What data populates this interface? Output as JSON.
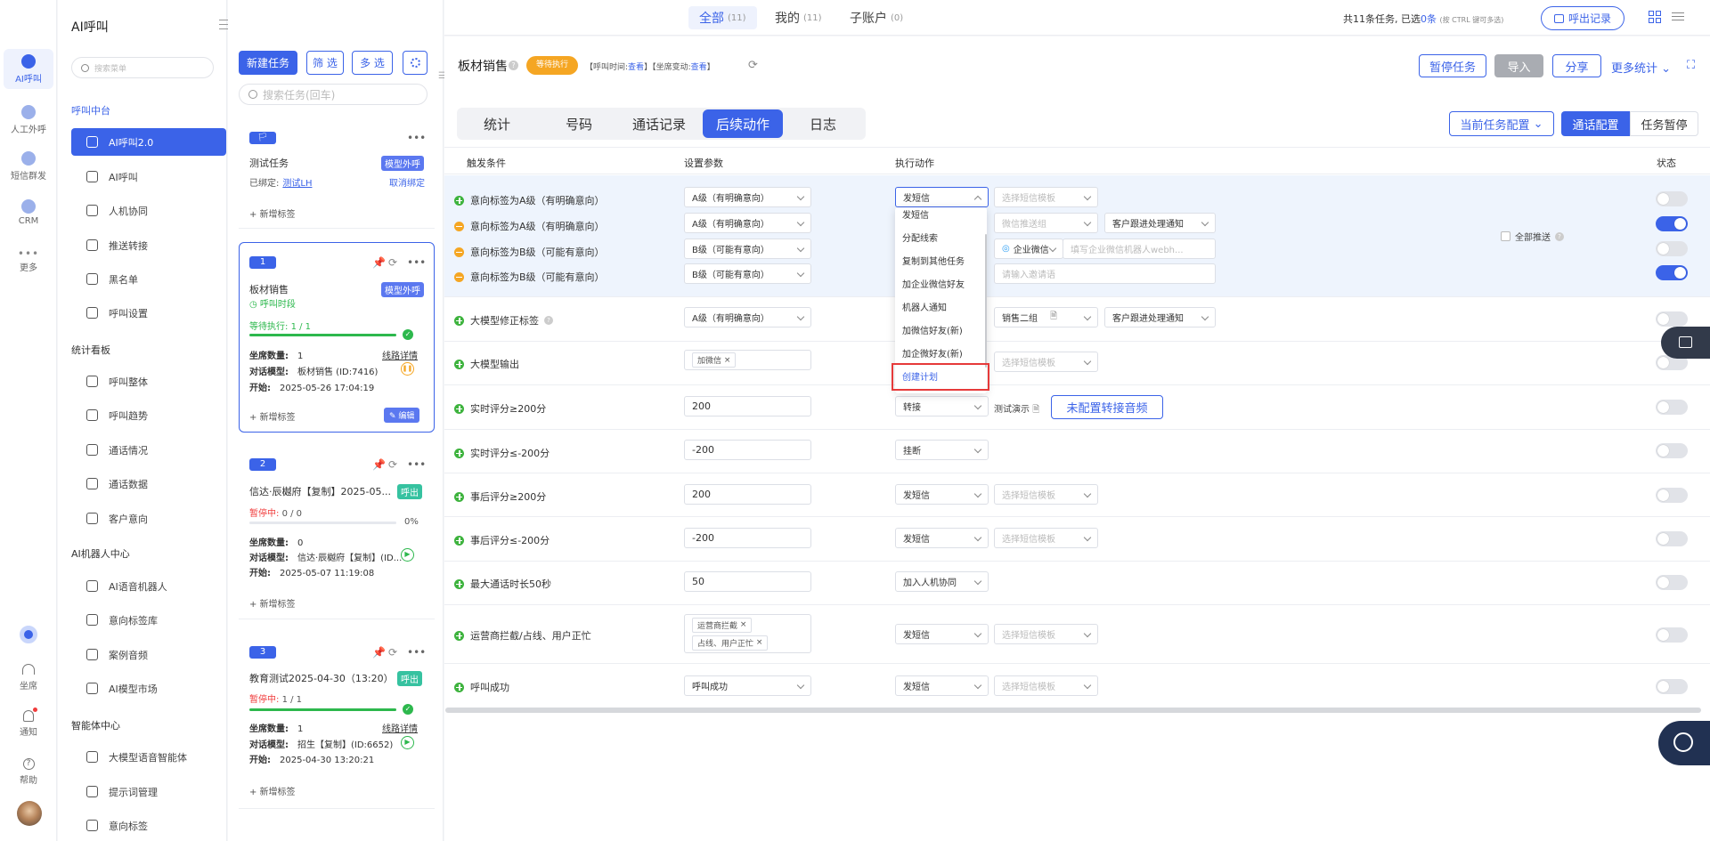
{
  "rail": {
    "items": [
      {
        "label": "AI呼叫",
        "active": true
      },
      {
        "label": "人工外呼"
      },
      {
        "label": "短信群发"
      },
      {
        "label": "CRM"
      },
      {
        "label": "更多"
      }
    ],
    "bottom": [
      {
        "label": "坐席"
      },
      {
        "label": "通知"
      },
      {
        "label": "帮助"
      }
    ]
  },
  "menu": {
    "title": "AI呼叫",
    "search_placeholder": "搜索菜单",
    "groups": [
      {
        "label": "呼叫中台",
        "items": [
          "AI呼叫2.0",
          "AI呼叫",
          "人机协同",
          "推送转接",
          "黑名单",
          "呼叫设置"
        ]
      },
      {
        "label": "统计看板",
        "items": [
          "呼叫整体",
          "呼叫趋势",
          "通话情况",
          "通话数据",
          "客户意向"
        ]
      },
      {
        "label": "AI机器人中心",
        "items": [
          "AI语音机器人",
          "意向标签库",
          "案例音频",
          "AI模型市场"
        ]
      },
      {
        "label": "智能体中心",
        "items": [
          "大模型语音智能体",
          "提示词管理",
          "意向标签"
        ]
      }
    ]
  },
  "tasks": {
    "new_label": "新建任务",
    "filter_label": "筛 选",
    "multi_label": "多 选",
    "search_placeholder": "搜索任务(回车)",
    "add_tag": "+ 新增标签",
    "cards": [
      {
        "badge": "🏳",
        "name": "测试任务",
        "tag": "模型外呼",
        "bound_label": "已绑定:",
        "bound_link": "测试LH",
        "unbind": "取消绑定"
      },
      {
        "badge": "1",
        "name": "板材销售",
        "tag": "模型外呼",
        "sub": "呼叫时段",
        "status": "等待执行:",
        "status_val": "1 / 1",
        "progress": 1.0,
        "seats_k": "坐席数量:",
        "seats_v": "1",
        "detail": "线路详情",
        "model_k": "对话模型:",
        "model_v": "板材销售 (ID:7416)",
        "start_k": "开始:",
        "start_v": "2025-05-26 17:04:19",
        "edit": "编辑"
      },
      {
        "badge": "2",
        "name": "信达·辰樾府【复制】2025-05...",
        "tag": "呼出",
        "status": "暂停中:",
        "status_val": "0 / 0",
        "progress": 0.0,
        "pct": "0%",
        "seats_k": "坐席数量:",
        "seats_v": "0",
        "model_k": "对话模型:",
        "model_v": "信达·辰樾府【复制】(ID...",
        "start_k": "开始:",
        "start_v": "2025-05-07 11:19:08"
      },
      {
        "badge": "3",
        "name": "教育测试2025-04-30（13:20）",
        "tag": "呼出",
        "status": "暂停中:",
        "status_val": "1 / 1",
        "progress": 1.0,
        "seats_k": "坐席数量:",
        "seats_v": "1",
        "detail": "线路详情",
        "model_k": "对话模型:",
        "model_v": "招生【复制】(ID:6652)",
        "start_k": "开始:",
        "start_v": "2025-04-30 13:20:21"
      }
    ]
  },
  "top": {
    "tabs": [
      {
        "label": "全部",
        "count": "(11)"
      },
      {
        "label": "我的",
        "count": "(11)"
      },
      {
        "label": "子账户",
        "count": "(0)"
      }
    ],
    "summary_a": "共11条任务, 已选",
    "summary_n": "0条",
    "summary_hint": "(按 CTRL 键可多选)",
    "record_btn": "呼出记录"
  },
  "header": {
    "task_name": "板材销售",
    "status": "等待执行",
    "meta1": "【呼叫时间:",
    "meta1_link": "查看",
    "meta2": "】【坐席变动:",
    "meta2_link": "查看",
    "meta3": "】",
    "pause_btn": "暂停任务",
    "import_btn": "导入",
    "share_btn": "分享",
    "more_btn": "更多统计"
  },
  "subtabs": [
    "统计",
    "号码",
    "通话记录",
    "后续动作",
    "日志"
  ],
  "active_subtab": "后续动作",
  "config": {
    "current": "当前任务配置",
    "call": "通话配置",
    "pause": "任务暂停"
  },
  "table": {
    "headers": {
      "trigger": "触发条件",
      "params": "设置参数",
      "action": "执行动作",
      "status": "状态"
    },
    "rows": [
      {
        "cond": "意向标签为A级（有明确意向）",
        "type": "plus",
        "param": "A级（有明确意向）",
        "action": "发短信",
        "extra": "选择短信模板",
        "on": false
      },
      {
        "cond": "意向标签为A级（有明确意向）",
        "type": "minus",
        "param": "A级（有明确意向）",
        "action": "",
        "extra": "微信推送组",
        "extra2": "客户跟进处理通知",
        "on": true
      },
      {
        "cond": "意向标签为B级（可能有意向）",
        "type": "minus",
        "param": "B级（可能有意向）",
        "action": "",
        "extra": "企业微信",
        "extra2": "填写企业微信机器人webh...",
        "on": false
      },
      {
        "cond": "意向标签为B级（可能有意向）",
        "type": "minus",
        "param": "B级（可能有意向）",
        "action": "",
        "extra": "请输入邀请语",
        "on": true
      },
      {
        "cond": "大模型修正标签",
        "type": "plus",
        "param": "A级（有明确意向）",
        "action": "",
        "extra": "销售二组",
        "extra2": "客户跟进处理通知",
        "on": false
      },
      {
        "cond": "大模型输出",
        "type": "plus",
        "chips": [
          "加微信"
        ],
        "action": "",
        "extra": "选择短信模板",
        "on": false
      },
      {
        "cond": "实时评分≥200分",
        "type": "plus",
        "input": "200",
        "action": "转接",
        "demo": "测试演示",
        "audio_btn": "未配置转接音频",
        "on": false
      },
      {
        "cond": "实时评分≤-200分",
        "type": "plus",
        "input": "-200",
        "action": "挂断",
        "on": false
      },
      {
        "cond": "事后评分≥200分",
        "type": "plus",
        "input": "200",
        "action": "发短信",
        "extra": "选择短信模板",
        "on": false
      },
      {
        "cond": "事后评分≤-200分",
        "type": "plus",
        "input": "-200",
        "action": "发短信",
        "extra": "选择短信模板",
        "on": false
      },
      {
        "cond": "最大通话时长50秒",
        "type": "plus",
        "input": "50",
        "action": "加入人机协同",
        "on": false
      },
      {
        "cond": "运营商拦截/占线、用户正忙",
        "type": "plus",
        "chips": [
          "运营商拦截",
          "占线、用户正忙"
        ],
        "action": "发短信",
        "extra": "选择短信模板",
        "on": false
      },
      {
        "cond": "呼叫成功",
        "type": "plus",
        "param": "呼叫成功",
        "action": "发短信",
        "extra": "选择短信模板",
        "on": false
      }
    ],
    "all_push": "全部推送"
  },
  "dropdown": {
    "items": [
      "发短信",
      "分配线索",
      "复制到其他任务",
      "加企业微信好友",
      "机器人通知",
      "加微信好友(新)",
      "加企微好友(新)",
      "创建计划"
    ],
    "highlight": "创建计划"
  }
}
